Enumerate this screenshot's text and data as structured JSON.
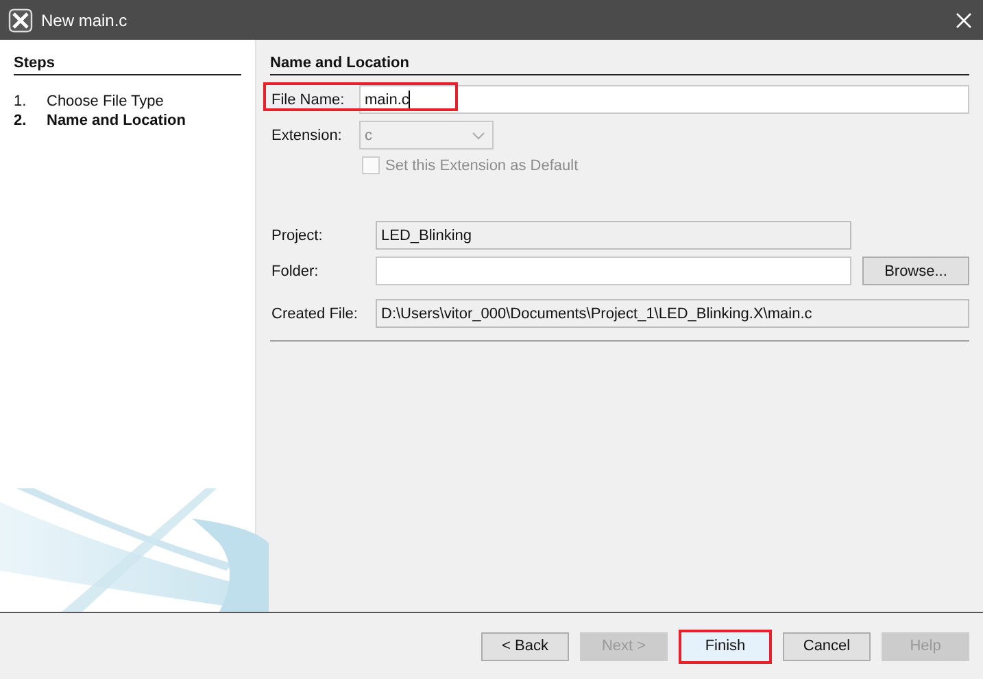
{
  "window": {
    "title": "New main.c"
  },
  "steps": {
    "title": "Steps",
    "items": [
      {
        "number": "1.",
        "label": "Choose File Type",
        "selected": false
      },
      {
        "number": "2.",
        "label": "Name and Location",
        "selected": true
      }
    ]
  },
  "panel": {
    "title": "Name and Location"
  },
  "file_name": {
    "label": "File Name:",
    "value": "main.c",
    "highlighted": true
  },
  "extension": {
    "label": "Extension:",
    "value": "c"
  },
  "default_checkbox": {
    "label": "Set this Extension as Default",
    "checked": false,
    "disabled": true
  },
  "project": {
    "label": "Project:",
    "value": "LED_Blinking"
  },
  "folder": {
    "label": "Folder:",
    "button": "Browse..."
  },
  "created_file": {
    "label": "Created File:",
    "value": "D:\\Users\\vitor_000\\Documents\\Project_1\\LED_Blinking.X\\main.c"
  },
  "buttons": [
    {
      "label": "< Back",
      "disabled": false,
      "highlighted": false
    },
    {
      "label": "Next >",
      "disabled": true,
      "highlighted": false
    },
    {
      "label": "Finish",
      "disabled": false,
      "highlighted": true
    },
    {
      "label": "Cancel",
      "disabled": false,
      "highlighted": false
    },
    {
      "label": "Help",
      "disabled": true,
      "highlighted": false
    }
  ]
}
